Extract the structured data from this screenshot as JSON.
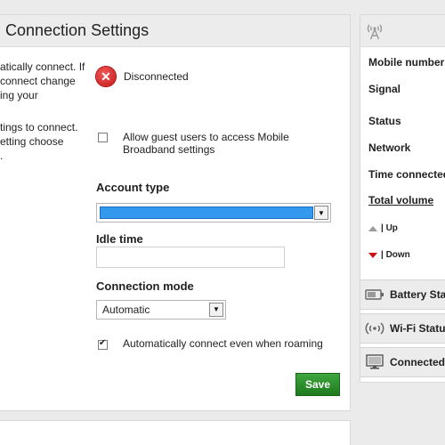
{
  "main": {
    "title": "Connection Settings",
    "left_text_1": [
      "atically connect. If",
      " connect change",
      "ing your"
    ],
    "left_text_2": [
      "tings to connect.",
      "etting choose",
      "."
    ],
    "status_text": "Disconnected",
    "guest_label": "Allow guest users to access Mobile Broadband settings",
    "guest_checked": false,
    "account_type_label": "Account type",
    "account_type_value": "",
    "idle_time_label": "Idle time",
    "idle_time_value": "",
    "connection_mode_label": "Connection mode",
    "connection_mode_value": "Automatic",
    "roaming_label": "Automatically connect even when roaming",
    "roaming_checked": true,
    "save_label": "Save"
  },
  "status_panel": {
    "labels": {
      "mobile_number": "Mobile number",
      "signal": "Signal",
      "status": "Status",
      "network": "Network",
      "time_connected": "Time connected",
      "total_volume": "Total volume",
      "up": "| Up",
      "down": "| Down"
    },
    "tabs": {
      "battery": "Battery Sta",
      "wifi": "Wi-Fi Status",
      "connected": "Connected"
    },
    "icons": [
      "tower-icon",
      "battery-icon",
      "wifi-icon",
      "monitor-icon"
    ]
  },
  "colors": {
    "accent_green": "#2a8f2a",
    "error_red": "#d01010",
    "selection_blue": "#3399ee"
  }
}
